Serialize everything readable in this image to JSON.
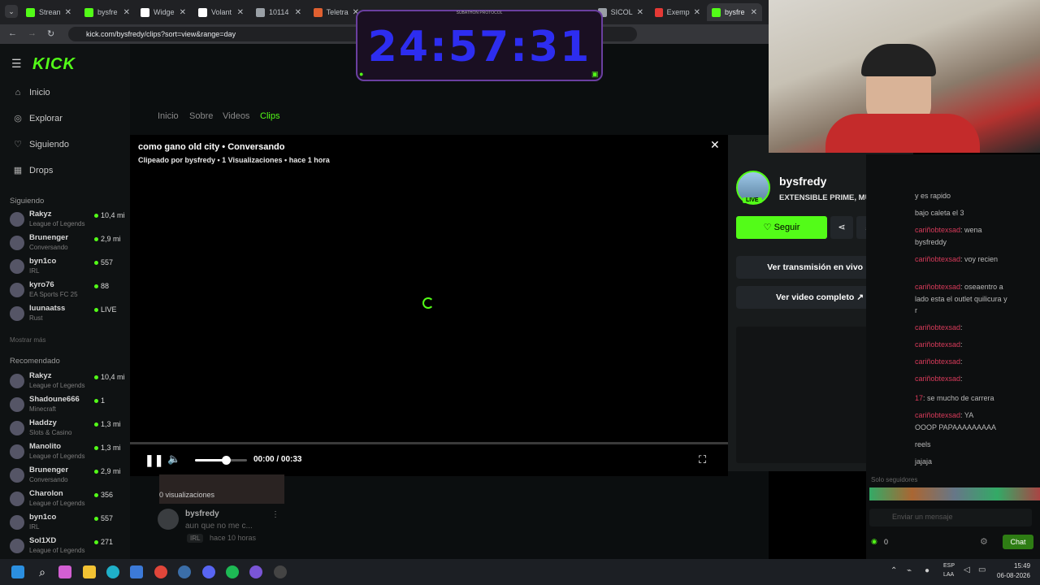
{
  "tabs": [
    {
      "label": "Strean",
      "color": "#53fc18"
    },
    {
      "label": "bysfre",
      "color": "#53fc18"
    },
    {
      "label": "Widge",
      "color": "#ffffff"
    },
    {
      "label": "Volant",
      "color": "#ffffff"
    },
    {
      "label": "10114",
      "color": "#9aa0a6"
    },
    {
      "label": "Teletra",
      "color": "#e06030"
    },
    {
      "label": "SICOL",
      "color": "#9aa0a6"
    },
    {
      "label": "Exemp",
      "color": "#e53935"
    },
    {
      "label": "bysfre",
      "color": "#53fc18"
    }
  ],
  "url": "kick.com/bysfredy/clips?sort=view&range=day",
  "kick_logo": "KICK",
  "nav": [
    "Inicio",
    "Explorar",
    "Siguiendo",
    "Drops"
  ],
  "following_heading": "Siguiendo",
  "following": [
    {
      "name": "Rakyz",
      "game": "League of Legends",
      "viewers": "10,4 mi"
    },
    {
      "name": "Brunenger",
      "game": "Conversando",
      "viewers": "2,9 mi"
    },
    {
      "name": "byn1co",
      "game": "IRL",
      "viewers": "557"
    },
    {
      "name": "kyro76",
      "game": "EA Sports FC 25",
      "viewers": "88"
    },
    {
      "name": "luunaatss",
      "game": "Rust",
      "viewers": "LIVE"
    }
  ],
  "show_more": "Mostrar más",
  "recommended_heading": "Recomendado",
  "recommended": [
    {
      "name": "Rakyz",
      "game": "League of Legends",
      "viewers": "10,4 mi"
    },
    {
      "name": "Shadoune666",
      "game": "Minecraft",
      "viewers": "1"
    },
    {
      "name": "Haddzy",
      "game": "Slots & Casino",
      "viewers": "1,3 mi"
    },
    {
      "name": "Manolito",
      "game": "League of Legends",
      "viewers": "1,3 mi"
    },
    {
      "name": "Brunenger",
      "game": "Conversando",
      "viewers": "2,9 mi"
    },
    {
      "name": "Charolon",
      "game": "League of Legends",
      "viewers": "356"
    },
    {
      "name": "byn1co",
      "game": "IRL",
      "viewers": "557"
    },
    {
      "name": "Sol1XD",
      "game": "League of Legends",
      "viewers": "271"
    }
  ],
  "page_tabs": [
    "Inicio",
    "Sobre",
    "Videos",
    "Clips"
  ],
  "clip": {
    "title": "como gano old city • Conversando",
    "meta": "Clipeado por bysfredy • 1 Visualizaciones • hace 1 hora",
    "time": "00:00 / 00:33",
    "volume_fraction": 0.6,
    "progress_fraction": 0.0
  },
  "below": {
    "views": "0 visualizaciones",
    "channel": "bysfredy",
    "desc": "aun que no me c...",
    "tag": "IRL",
    "ago": "hace 10 horas"
  },
  "panel": {
    "channel": "bysfredy",
    "live_badge": "LIVE",
    "title": "EXTENSIBLE PRIME, MUCH...",
    "follow": "Seguir",
    "watch_live": "Ver transmisión en vivo",
    "watch_full": "Ver video completo"
  },
  "chat": [
    {
      "user": "",
      "text": "y es rapido"
    },
    {
      "user": "",
      "text": "bajo caleta el 3"
    },
    {
      "user": "cariñobtexsad",
      "text": ": wena"
    },
    {
      "user": "",
      "text": "bysfreddy"
    },
    {
      "user": "cariñobtexsad",
      "text": ": voy recien"
    },
    {
      "user": "cariñobtexsad",
      "text": ": oseaentro a"
    },
    {
      "user": "",
      "text": "lado esta el outlet quilicura y"
    },
    {
      "user": "",
      "text": "r"
    },
    {
      "user": "cariñobtexsad",
      "text": ":"
    },
    {
      "user": "cariñobtexsad",
      "text": ":"
    },
    {
      "user": "cariñobtexsad",
      "text": ":"
    },
    {
      "user": "cariñobtexsad",
      "text": ":"
    },
    {
      "user": "17",
      "text": ": se mucho de carrera"
    },
    {
      "user": "cariñobtexsad",
      "text": ": YA"
    },
    {
      "user": "",
      "text": "OOOP PAPAAAAAAAAA"
    },
    {
      "user": "",
      "text": "reels"
    },
    {
      "user": "",
      "text": "jajaja"
    }
  ],
  "chat_followers_only": "Solo seguidores",
  "chat_placeholder": "Enviar un mensaje",
  "chat_count": "0",
  "chat_button": "Chat",
  "timer": "24:57:31",
  "timer_caption": "SUBATHON PROTOCOL",
  "tray": {
    "lang": "ESP",
    "layout": "LAA",
    "time": "15:49",
    "date": "06-08-2026"
  }
}
